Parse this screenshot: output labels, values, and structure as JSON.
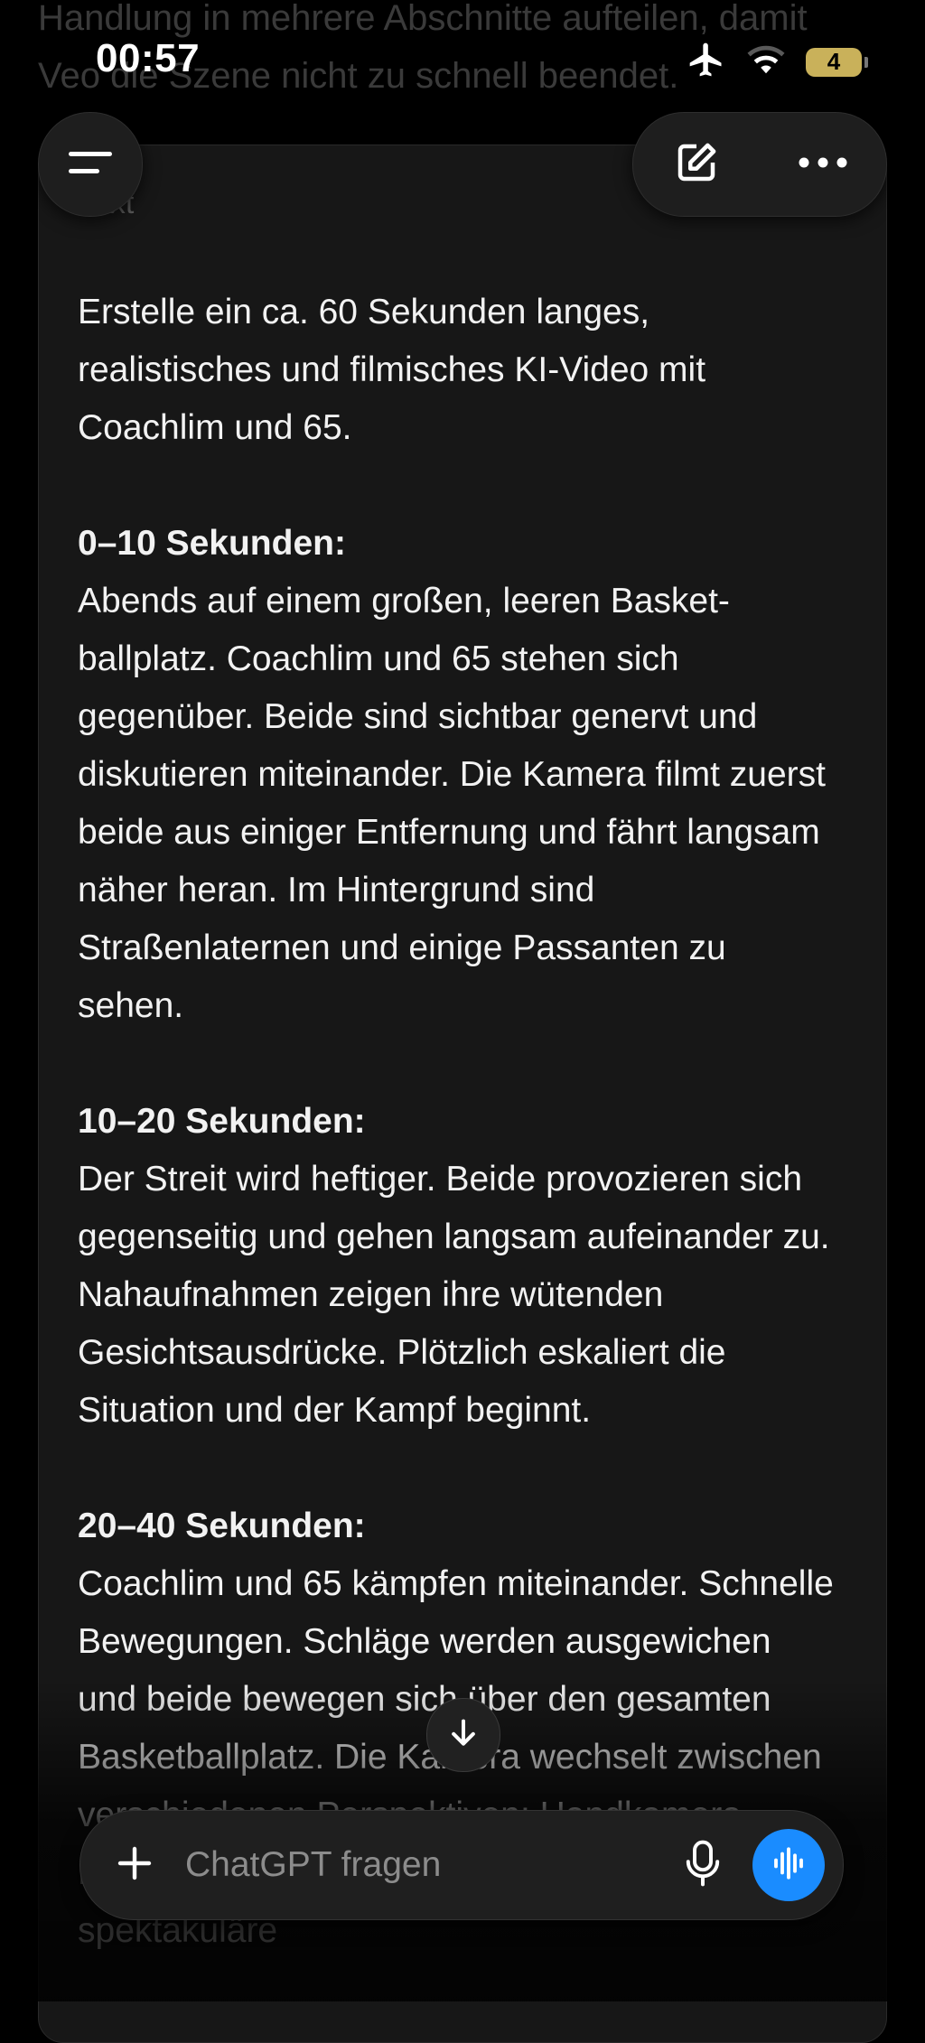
{
  "background": {
    "lines": [
      "Handlung in mehrere Abschnitte aufteilen, damit",
      "Veo die Szene nicht zu schnell beendet."
    ]
  },
  "status_bar": {
    "time": "00:57",
    "battery": "4",
    "icons": [
      "airplane-icon",
      "wifi-icon",
      "battery-icon"
    ]
  },
  "header": {
    "menu_icon": "menu-icon",
    "new_chat_icon": "edit-icon",
    "more_icon": "more-icon"
  },
  "card": {
    "label": "Text",
    "intro": "Erstelle ein ca. 60 Sekunden langes, realistisches und filmisches KI-Video mit Coachlim und 65.",
    "sections": [
      {
        "heading": "0–10 Sekunden:",
        "text": "Abends auf einem großen, leeren Basket-ballplatz. Coachlim und 65 stehen sich gegenüber. Beide sind sichtbar genervt und diskutieren miteinander. Die Kamera filmt zuerst beide aus einiger Entfernung und fährt langsam näher heran. Im Hintergrund sind Straßenlaternen und einige Passanten zu sehen."
      },
      {
        "heading": "10–20 Sekunden:",
        "text": "Der Streit wird heftiger. Beide provozieren sich gegenseitig und gehen langsam aufeinander zu. Nahaufnahmen zeigen ihre wütenden Gesichtsausdrücke. Plötzlich eskaliert die Situation und der Kampf beginnt."
      },
      {
        "heading": "20–40 Sekunden:",
        "text": "Coachlim und 65 kämpfen miteinander. Schnelle Bewegungen. Schläge werden ausgewichen und beide bewegen sich über den gesamten Basketballplatz. Die Kamera wechselt zwischen verschiedenen Perspektiven: Handkamera, Nahaufnahmen und weite Aufnahmen. Einige spektakuläre"
      }
    ]
  },
  "composer": {
    "placeholder": "ChatGPT fragen",
    "accent": "#1a8cff"
  }
}
